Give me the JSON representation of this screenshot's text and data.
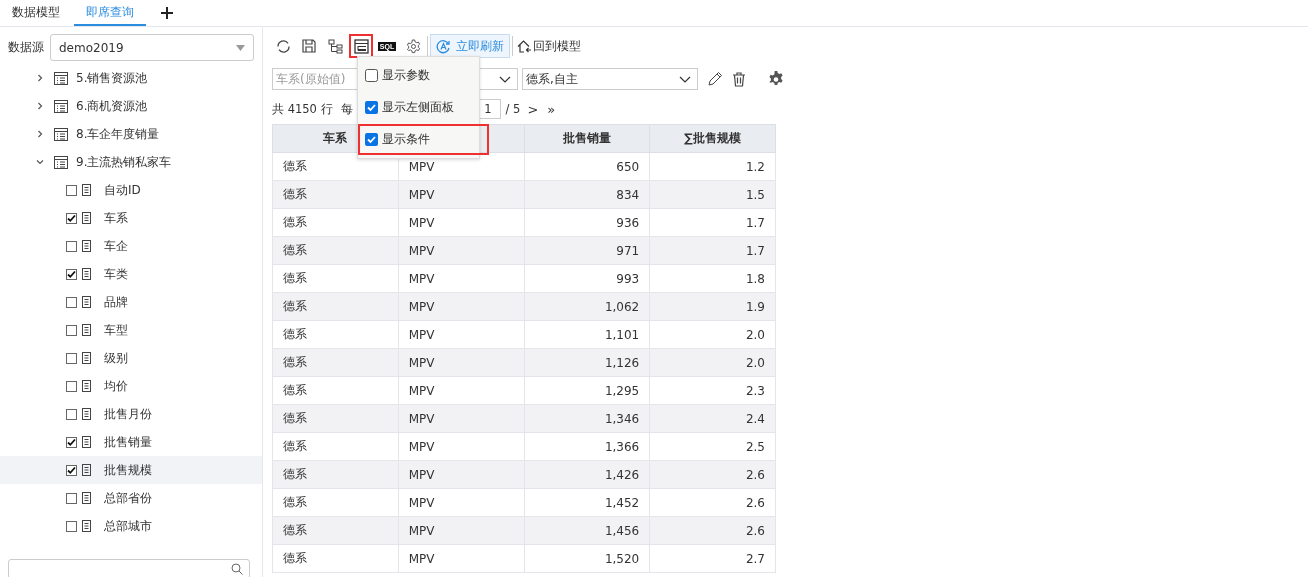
{
  "tabs": [
    {
      "label": "数据模型",
      "selected": false
    },
    {
      "label": "即席查询",
      "selected": true
    }
  ],
  "sidebar": {
    "datasource_label": "数据源",
    "datasource": "demo2019",
    "tree": [
      {
        "label": "5.销售资源池",
        "expanded": false
      },
      {
        "label": "6.商机资源池",
        "expanded": false
      },
      {
        "label": "8.车企年度销量",
        "expanded": false
      },
      {
        "label": "9.主流热销私家车",
        "expanded": true,
        "children": [
          {
            "label": "自动ID",
            "checked": false,
            "selected": false
          },
          {
            "label": "车系",
            "checked": true,
            "selected": false
          },
          {
            "label": "车企",
            "checked": false,
            "selected": false
          },
          {
            "label": "车类",
            "checked": true,
            "selected": false
          },
          {
            "label": "品牌",
            "checked": false,
            "selected": false
          },
          {
            "label": "车型",
            "checked": false,
            "selected": false
          },
          {
            "label": "级别",
            "checked": false,
            "selected": false
          },
          {
            "label": "均价",
            "checked": false,
            "selected": false
          },
          {
            "label": "批售月份",
            "checked": false,
            "selected": false
          },
          {
            "label": "批售销量",
            "checked": true,
            "selected": false
          },
          {
            "label": "批售规模",
            "checked": true,
            "selected": true
          },
          {
            "label": "总部省份",
            "checked": false,
            "selected": false
          },
          {
            "label": "总部城市",
            "checked": false,
            "selected": false
          }
        ]
      }
    ]
  },
  "toolbar": [
    {
      "kind": "refresh",
      "highlighted": false
    },
    {
      "kind": "save",
      "highlighted": false
    },
    {
      "kind": "hierarchy",
      "highlighted": false
    },
    {
      "kind": "layout",
      "highlighted": true
    },
    {
      "kind": "sql",
      "label": "SQL",
      "highlighted": false
    },
    {
      "kind": "gear",
      "highlighted": false
    },
    {
      "kind": "refresh-now",
      "label": "立即刷新",
      "highlighted": false
    },
    {
      "kind": "home",
      "label": "回到模型",
      "highlighted": false
    }
  ],
  "menu": [
    {
      "label": "显示参数",
      "checked": false,
      "highlighted": false
    },
    {
      "label": "显示左侧面板",
      "checked": true,
      "highlighted": false
    },
    {
      "label": "显示条件",
      "checked": true,
      "highlighted": true
    }
  ],
  "filters": [
    {
      "placeholder": "车系(原始值)"
    },
    {
      "value": "德系,自主"
    }
  ],
  "pagination": {
    "total": "共 4150 行",
    "per_page_fragment": "每",
    "page": "1",
    "pages": "/ 5",
    "next": ">",
    "last": "»"
  },
  "table": {
    "columns": [
      {
        "label": "车系"
      },
      {},
      {
        "label": "批售销量"
      },
      {
        "label": "∑批售规模"
      }
    ],
    "rows": [
      [
        "德系",
        "MPV",
        "650",
        "1.2"
      ],
      [
        "德系",
        "MPV",
        "834",
        "1.5"
      ],
      [
        "德系",
        "MPV",
        "936",
        "1.7"
      ],
      [
        "德系",
        "MPV",
        "971",
        "1.7"
      ],
      [
        "德系",
        "MPV",
        "993",
        "1.8"
      ],
      [
        "德系",
        "MPV",
        "1,062",
        "1.9"
      ],
      [
        "德系",
        "MPV",
        "1,101",
        "2.0"
      ],
      [
        "德系",
        "MPV",
        "1,126",
        "2.0"
      ],
      [
        "德系",
        "MPV",
        "1,295",
        "2.3"
      ],
      [
        "德系",
        "MPV",
        "1,346",
        "2.4"
      ],
      [
        "德系",
        "MPV",
        "1,366",
        "2.5"
      ],
      [
        "德系",
        "MPV",
        "1,426",
        "2.6"
      ],
      [
        "德系",
        "MPV",
        "1,452",
        "2.6"
      ],
      [
        "德系",
        "MPV",
        "1,456",
        "2.6"
      ],
      [
        "德系",
        "MPV",
        "1,520",
        "2.7"
      ]
    ]
  }
}
